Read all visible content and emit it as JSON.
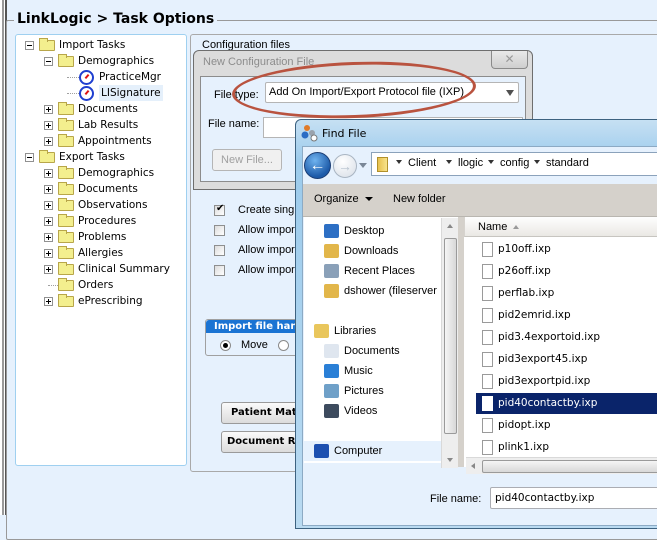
{
  "page": {
    "title": "LinkLogic > Task Options"
  },
  "tree": {
    "items": [
      {
        "label": "Import Tasks",
        "level": 0,
        "expander": "minus",
        "icon": "folder-icon"
      },
      {
        "label": "Demographics",
        "level": 1,
        "expander": "minus",
        "icon": "folder-icon"
      },
      {
        "label": "PracticeMgr",
        "level": 2,
        "expander": "none",
        "icon": "clock-icon"
      },
      {
        "label": "LISignature",
        "level": 2,
        "expander": "none",
        "icon": "clock-icon",
        "selected": true
      },
      {
        "label": "Documents",
        "level": 1,
        "expander": "plus",
        "icon": "folder-icon"
      },
      {
        "label": "Lab Results",
        "level": 1,
        "expander": "plus",
        "icon": "folder-icon"
      },
      {
        "label": "Appointments",
        "level": 1,
        "expander": "plus",
        "icon": "folder-icon"
      },
      {
        "label": "Export Tasks",
        "level": 0,
        "expander": "minus",
        "icon": "folder-icon"
      },
      {
        "label": "Demographics",
        "level": 1,
        "expander": "plus",
        "icon": "folder-icon"
      },
      {
        "label": "Documents",
        "level": 1,
        "expander": "plus",
        "icon": "folder-icon"
      },
      {
        "label": "Observations",
        "level": 1,
        "expander": "plus",
        "icon": "folder-icon"
      },
      {
        "label": "Procedures",
        "level": 1,
        "expander": "plus",
        "icon": "folder-icon"
      },
      {
        "label": "Problems",
        "level": 1,
        "expander": "plus",
        "icon": "folder-icon"
      },
      {
        "label": "Allergies",
        "level": 1,
        "expander": "plus",
        "icon": "folder-icon"
      },
      {
        "label": "Clinical Summary",
        "level": 1,
        "expander": "plus",
        "icon": "folder-icon"
      },
      {
        "label": "Orders",
        "level": 1,
        "expander": "none",
        "icon": "folder-icon"
      },
      {
        "label": "ePrescribing",
        "level": 1,
        "expander": "plus",
        "icon": "folder-icon"
      }
    ]
  },
  "options": {
    "config_files_label": "Configuration files",
    "checkboxes": [
      {
        "label": "Create sing",
        "checked": true
      },
      {
        "label": "Allow impor",
        "checked": false
      },
      {
        "label": "Allow impor",
        "checked": false
      },
      {
        "label": "Allow impor",
        "checked": false
      }
    ],
    "import_group_title": "Import file han",
    "radio_move_label": "Move",
    "radio_move_selected": true,
    "patient_match_button": "Patient Mat",
    "document_button": "Document R"
  },
  "new_config_dialog": {
    "title": "New Configuration File",
    "close_glyph": "✕",
    "file_type_label": "File type:",
    "file_type_value": "Add On Import/Export Protocol file (IXP)",
    "file_name_label": "File name:",
    "file_name_value": "",
    "new_file_button": "New File..."
  },
  "find_file_dialog": {
    "title": "Find File",
    "breadcrumb": [
      "Client",
      "llogic",
      "config",
      "standard"
    ],
    "toolbar": {
      "organize": "Organize",
      "new_folder": "New folder"
    },
    "nav_pane": [
      {
        "label": "Desktop",
        "icon": "desktop-icon"
      },
      {
        "label": "Downloads",
        "icon": "downloads-icon"
      },
      {
        "label": "Recent Places",
        "icon": "recent-places-icon"
      },
      {
        "label": "dshower (fileserver",
        "icon": "network-folder-icon"
      },
      {
        "label": "Libraries",
        "icon": "libraries-icon"
      },
      {
        "label": "Documents",
        "icon": "documents-icon"
      },
      {
        "label": "Music",
        "icon": "music-icon"
      },
      {
        "label": "Pictures",
        "icon": "pictures-icon"
      },
      {
        "label": "Videos",
        "icon": "videos-icon"
      },
      {
        "label": "Computer",
        "icon": "computer-icon",
        "selected": true
      }
    ],
    "column_name": "Name",
    "files": [
      {
        "name": "p10off.ixp"
      },
      {
        "name": "p26off.ixp"
      },
      {
        "name": "perflab.ixp"
      },
      {
        "name": "pid2emrid.ixp"
      },
      {
        "name": "pid3.4exportoid.ixp"
      },
      {
        "name": "pid3export45.ixp"
      },
      {
        "name": "pid3exportpid.ixp"
      },
      {
        "name": "pid40contactby.ixp",
        "selected": true
      },
      {
        "name": "pidopt.ixp"
      },
      {
        "name": "plink1.ixp"
      }
    ],
    "file_name_label": "File name:",
    "file_name_value": "pid40contactby.ixp"
  },
  "colors": {
    "background": "#e6f1fd",
    "selection": "#0a246a",
    "annotation_oval": "#b9533f",
    "group_header": "#1b74d3"
  }
}
